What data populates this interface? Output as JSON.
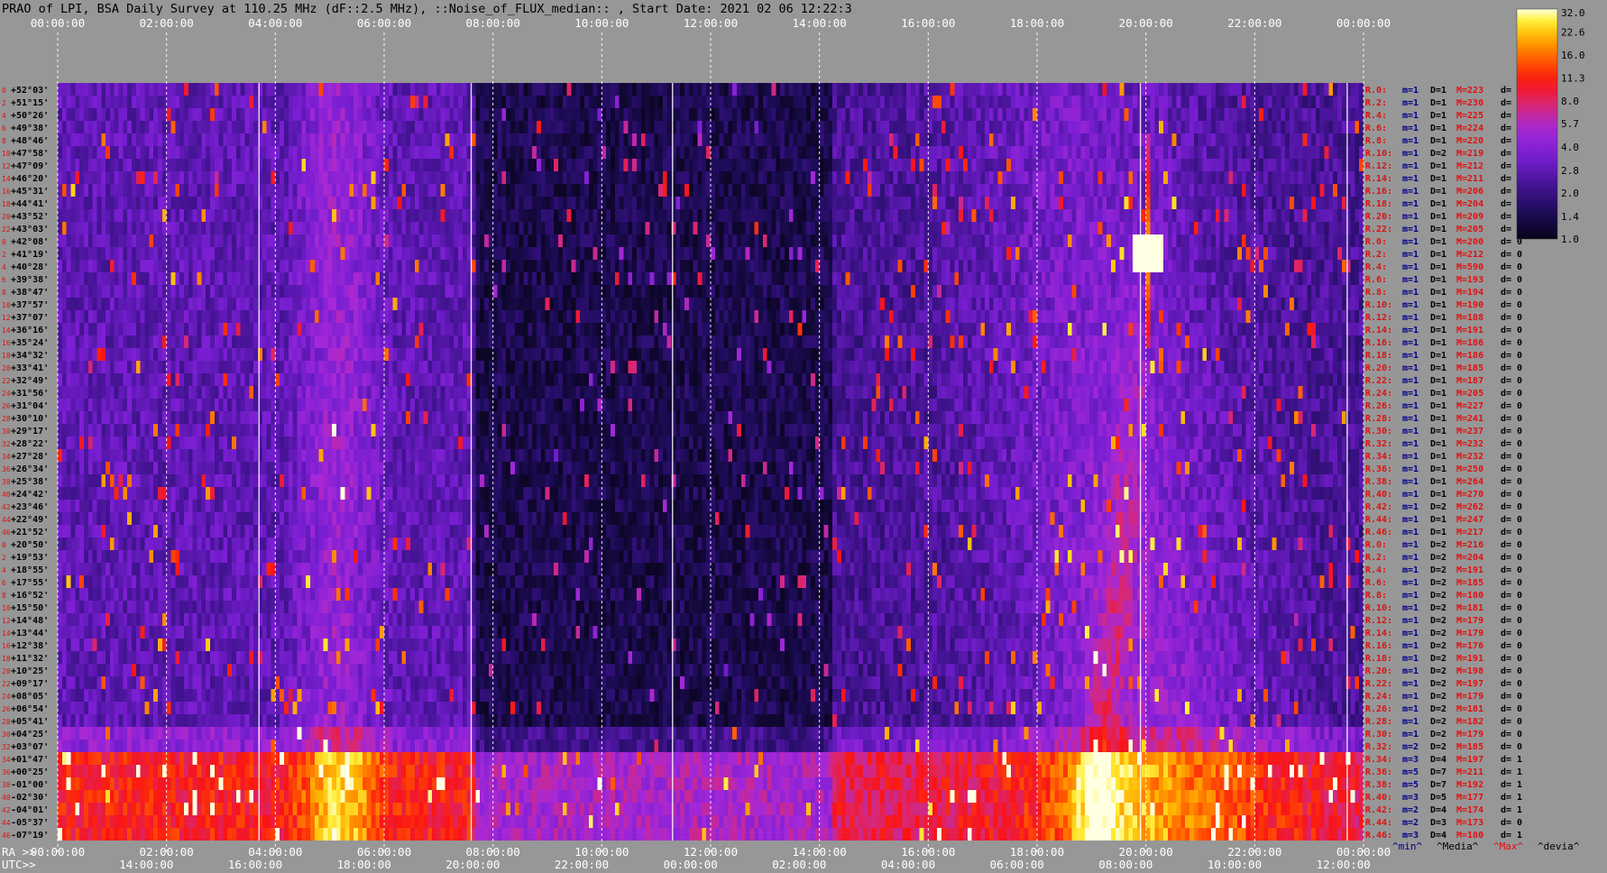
{
  "chart_data": {
    "type": "heatmap",
    "title": "PRAO of LPI, BSA Daily Survey at 110.25 MHz (dF::2.5 MHz), ::Noise_of_FLUX_median:: , Start Date: 2021 02 06 12:22:3",
    "x_top_ticks": [
      "00:00:00",
      "02:00:00",
      "04:00:00",
      "06:00:00",
      "08:00:00",
      "10:00:00",
      "12:00:00",
      "14:00:00",
      "16:00:00",
      "18:00:00",
      "20:00:00",
      "22:00:00",
      "00:00:00"
    ],
    "x_bottom_label_ra": "RA >>",
    "x_bottom_ticks_ra": [
      "00:00:00",
      "02:00:00",
      "04:00:00",
      "06:00:00",
      "08:00:00",
      "10:00:00",
      "12:00:00",
      "14:00:00",
      "16:00:00",
      "18:00:00",
      "20:00:00",
      "22:00:00",
      "00:00:00"
    ],
    "x_bottom_label_utc": "UTC>>",
    "x_bottom_ticks_utc": [
      "14:00:00",
      "16:00:00",
      "18:00:00",
      "20:00:00",
      "22:00:00",
      "00:00:00",
      "02:00:00",
      "04:00:00",
      "06:00:00",
      "08:00:00",
      "10:00:00",
      "12:00:00"
    ],
    "y_row_indices": [
      "0",
      "2",
      "4",
      "6",
      "8",
      "10",
      "12",
      "14",
      "16",
      "18",
      "20",
      "22",
      "0",
      "2",
      "4",
      "6",
      "8",
      "10",
      "12",
      "14",
      "16",
      "18",
      "20",
      "22",
      "24",
      "26",
      "28",
      "30",
      "32",
      "34",
      "36",
      "38",
      "40",
      "42",
      "44",
      "46",
      "0",
      "2",
      "4",
      "6",
      "8",
      "10",
      "12",
      "14",
      "16",
      "18",
      "20",
      "22",
      "24",
      "26",
      "28",
      "30",
      "32",
      "34",
      "36",
      "38",
      "40",
      "42",
      "44",
      "46"
    ],
    "y_labels": [
      "+52°03'",
      "+51°15'",
      "+50°26'",
      "+49°38'",
      "+48°46'",
      "+47°58'",
      "+47°09'",
      "+46°20'",
      "+45°31'",
      "+44°41'",
      "+43°52'",
      "+43°03'",
      "+42°08'",
      "+41°19'",
      "+40°28'",
      "+39°38'",
      "+38°47'",
      "+37°57'",
      "+37°07'",
      "+36°16'",
      "+35°24'",
      "+34°32'",
      "+33°41'",
      "+32°49'",
      "+31°56'",
      "+31°04'",
      "+30°10'",
      "+29°17'",
      "+28°22'",
      "+27°28'",
      "+26°34'",
      "+25°38'",
      "+24°42'",
      "+23°46'",
      "+22°49'",
      "+21°52'",
      "+20°50'",
      "+19°53'",
      "+18°55'",
      "+17°55'",
      "+16°52'",
      "+15°50'",
      "+14°48'",
      "+13°44'",
      "+12°38'",
      "+11°32'",
      "+10°25'",
      "+09°17'",
      "+08°05'",
      "+06°54'",
      "+05°41'",
      "+04°25'",
      "+03°07'",
      "+01°47'",
      "+00°25'",
      "-01°00'",
      "-02°30'",
      "-04°01'",
      "-05°37'",
      "-07°19'"
    ],
    "right_stats": [
      {
        "r": "R.0:",
        "m": "m=1",
        "d": "D=1",
        "M": "M=223",
        "dd": "d= 0"
      },
      {
        "r": "R.2:",
        "m": "m=1",
        "d": "D=1",
        "M": "M=230",
        "dd": "d= 0"
      },
      {
        "r": "R.4:",
        "m": "m=1",
        "d": "D=1",
        "M": "M=225",
        "dd": "d= 0"
      },
      {
        "r": "R.6:",
        "m": "m=1",
        "d": "D=1",
        "M": "M=224",
        "dd": "d= 0"
      },
      {
        "r": "R.8:",
        "m": "m=1",
        "d": "D=1",
        "M": "M=220",
        "dd": "d= 0"
      },
      {
        "r": "R.10:",
        "m": "m=1",
        "d": "D=2",
        "M": "M=219",
        "dd": "d= 0"
      },
      {
        "r": "R.12:",
        "m": "m=1",
        "d": "D=1",
        "M": "M=212",
        "dd": "d="
      },
      {
        "r": "R.14:",
        "m": "m=1",
        "d": "D=1",
        "M": "M=211",
        "dd": "d="
      },
      {
        "r": "R.16:",
        "m": "m=1",
        "d": "D=1",
        "M": "M=206",
        "dd": "d="
      },
      {
        "r": "R.18:",
        "m": "m=1",
        "d": "D=1",
        "M": "M=204",
        "dd": "d="
      },
      {
        "r": "R.20:",
        "m": "m=1",
        "d": "D=1",
        "M": "M=209",
        "dd": "d="
      },
      {
        "r": "R.22:",
        "m": "m=1",
        "d": "D=1",
        "M": "M=205",
        "dd": "d="
      },
      {
        "r": "R.0:",
        "m": "m=1",
        "d": "D=1",
        "M": "M=200",
        "dd": "d= 0"
      },
      {
        "r": "R.2:",
        "m": "m=1",
        "d": "D=1",
        "M": "M=212",
        "dd": "d= 0"
      },
      {
        "r": "R.4:",
        "m": "m=1",
        "d": "D=1",
        "M": "M=590",
        "dd": "d= 0"
      },
      {
        "r": "R.6:",
        "m": "m=1",
        "d": "D=1",
        "M": "M=193",
        "dd": "d= 0"
      },
      {
        "r": "R.8:",
        "m": "m=1",
        "d": "D=1",
        "M": "M=194",
        "dd": "d= 0"
      },
      {
        "r": "R.10:",
        "m": "m=1",
        "d": "D=1",
        "M": "M=190",
        "dd": "d= 0"
      },
      {
        "r": "R.12:",
        "m": "m=1",
        "d": "D=1",
        "M": "M=188",
        "dd": "d= 0"
      },
      {
        "r": "R.14:",
        "m": "m=1",
        "d": "D=1",
        "M": "M=191",
        "dd": "d= 0"
      },
      {
        "r": "R.16:",
        "m": "m=1",
        "d": "D=1",
        "M": "M=186",
        "dd": "d= 0"
      },
      {
        "r": "R.18:",
        "m": "m=1",
        "d": "D=1",
        "M": "M=186",
        "dd": "d= 0"
      },
      {
        "r": "R.20:",
        "m": "m=1",
        "d": "D=1",
        "M": "M=185",
        "dd": "d= 0"
      },
      {
        "r": "R.22:",
        "m": "m=1",
        "d": "D=1",
        "M": "M=187",
        "dd": "d= 0"
      },
      {
        "r": "R.24:",
        "m": "m=1",
        "d": "D=1",
        "M": "M=205",
        "dd": "d= 0"
      },
      {
        "r": "R.26:",
        "m": "m=1",
        "d": "D=1",
        "M": "M=227",
        "dd": "d= 0"
      },
      {
        "r": "R.28:",
        "m": "m=1",
        "d": "D=1",
        "M": "M=241",
        "dd": "d= 0"
      },
      {
        "r": "R.30:",
        "m": "m=1",
        "d": "D=1",
        "M": "M=237",
        "dd": "d= 0"
      },
      {
        "r": "R.32:",
        "m": "m=1",
        "d": "D=1",
        "M": "M=232",
        "dd": "d= 0"
      },
      {
        "r": "R.34:",
        "m": "m=1",
        "d": "D=1",
        "M": "M=232",
        "dd": "d= 0"
      },
      {
        "r": "R.36:",
        "m": "m=1",
        "d": "D=1",
        "M": "M=250",
        "dd": "d= 0"
      },
      {
        "r": "R.38:",
        "m": "m=1",
        "d": "D=1",
        "M": "M=264",
        "dd": "d= 0"
      },
      {
        "r": "R.40:",
        "m": "m=1",
        "d": "D=1",
        "M": "M=270",
        "dd": "d= 0"
      },
      {
        "r": "R.42:",
        "m": "m=1",
        "d": "D=2",
        "M": "M=262",
        "dd": "d= 0"
      },
      {
        "r": "R.44:",
        "m": "m=1",
        "d": "D=1",
        "M": "M=247",
        "dd": "d= 0"
      },
      {
        "r": "R.46:",
        "m": "m=1",
        "d": "D=1",
        "M": "M=217",
        "dd": "d= 0"
      },
      {
        "r": "R.0:",
        "m": "m=1",
        "d": "D=2",
        "M": "M=216",
        "dd": "d= 0"
      },
      {
        "r": "R.2:",
        "m": "m=1",
        "d": "D=2",
        "M": "M=204",
        "dd": "d= 0"
      },
      {
        "r": "R.4:",
        "m": "m=1",
        "d": "D=2",
        "M": "M=191",
        "dd": "d= 0"
      },
      {
        "r": "R.6:",
        "m": "m=1",
        "d": "D=2",
        "M": "M=185",
        "dd": "d= 0"
      },
      {
        "r": "R.8:",
        "m": "m=1",
        "d": "D=2",
        "M": "M=180",
        "dd": "d= 0"
      },
      {
        "r": "R.10:",
        "m": "m=1",
        "d": "D=2",
        "M": "M=181",
        "dd": "d= 0"
      },
      {
        "r": "R.12:",
        "m": "m=1",
        "d": "D=2",
        "M": "M=179",
        "dd": "d= 0"
      },
      {
        "r": "R.14:",
        "m": "m=1",
        "d": "D=2",
        "M": "M=179",
        "dd": "d= 0"
      },
      {
        "r": "R.16:",
        "m": "m=1",
        "d": "D=2",
        "M": "M=176",
        "dd": "d= 0"
      },
      {
        "r": "R.18:",
        "m": "m=1",
        "d": "D=2",
        "M": "M=191",
        "dd": "d= 0"
      },
      {
        "r": "R.20:",
        "m": "m=1",
        "d": "D=2",
        "M": "M=198",
        "dd": "d= 0"
      },
      {
        "r": "R.22:",
        "m": "m=1",
        "d": "D=2",
        "M": "M=197",
        "dd": "d= 0"
      },
      {
        "r": "R.24:",
        "m": "m=1",
        "d": "D=2",
        "M": "M=179",
        "dd": "d= 0"
      },
      {
        "r": "R.26:",
        "m": "m=1",
        "d": "D=2",
        "M": "M=181",
        "dd": "d= 0"
      },
      {
        "r": "R.28:",
        "m": "m=1",
        "d": "D=2",
        "M": "M=182",
        "dd": "d= 0"
      },
      {
        "r": "R.30:",
        "m": "m=1",
        "d": "D=2",
        "M": "M=179",
        "dd": "d= 0"
      },
      {
        "r": "R.32:",
        "m": "m=2",
        "d": "D=2",
        "M": "M=185",
        "dd": "d= 0"
      },
      {
        "r": "R.34:",
        "m": "m=3",
        "d": "D=4",
        "M": "M=197",
        "dd": "d= 1"
      },
      {
        "r": "R.36:",
        "m": "m=5",
        "d": "D=7",
        "M": "M=211",
        "dd": "d= 1"
      },
      {
        "r": "R.38:",
        "m": "m=5",
        "d": "D=7",
        "M": "M=192",
        "dd": "d= 1"
      },
      {
        "r": "R.40:",
        "m": "m=3",
        "d": "D=5",
        "M": "M=177",
        "dd": "d= 1"
      },
      {
        "r": "R.42:",
        "m": "m=2",
        "d": "D=4",
        "M": "M=174",
        "dd": "d= 1"
      },
      {
        "r": "R.44:",
        "m": "m=2",
        "d": "D=3",
        "M": "M=173",
        "dd": "d= 0"
      },
      {
        "r": "R.46:",
        "m": "m=3",
        "d": "D=4",
        "M": "M=180",
        "dd": "d= 1"
      }
    ],
    "legend_stats": [
      "^min^",
      "^Media^",
      "^Max^",
      "^devia^"
    ],
    "colorbar": {
      "ticks": [
        "32.0",
        "22.6",
        "16.0",
        "11.3",
        "8.0",
        "5.7",
        "4.0",
        "2.8",
        "2.0",
        "1.4",
        "1.0"
      ],
      "scale": "log",
      "range": [
        1.0,
        32.0
      ]
    },
    "features": [
      {
        "name": "bright horizontal band (Galactic plane region)",
        "dec_range": [
          "+03°07'",
          "-07°19'"
        ],
        "level": "high"
      },
      {
        "name": "strong point source",
        "ra": "20:00:00",
        "dec": "+41°19'",
        "level": 32
      },
      {
        "name": "dark low-noise region",
        "ra_range": [
          "08:00:00",
          "14:00:00"
        ],
        "level": 1.1
      }
    ]
  }
}
